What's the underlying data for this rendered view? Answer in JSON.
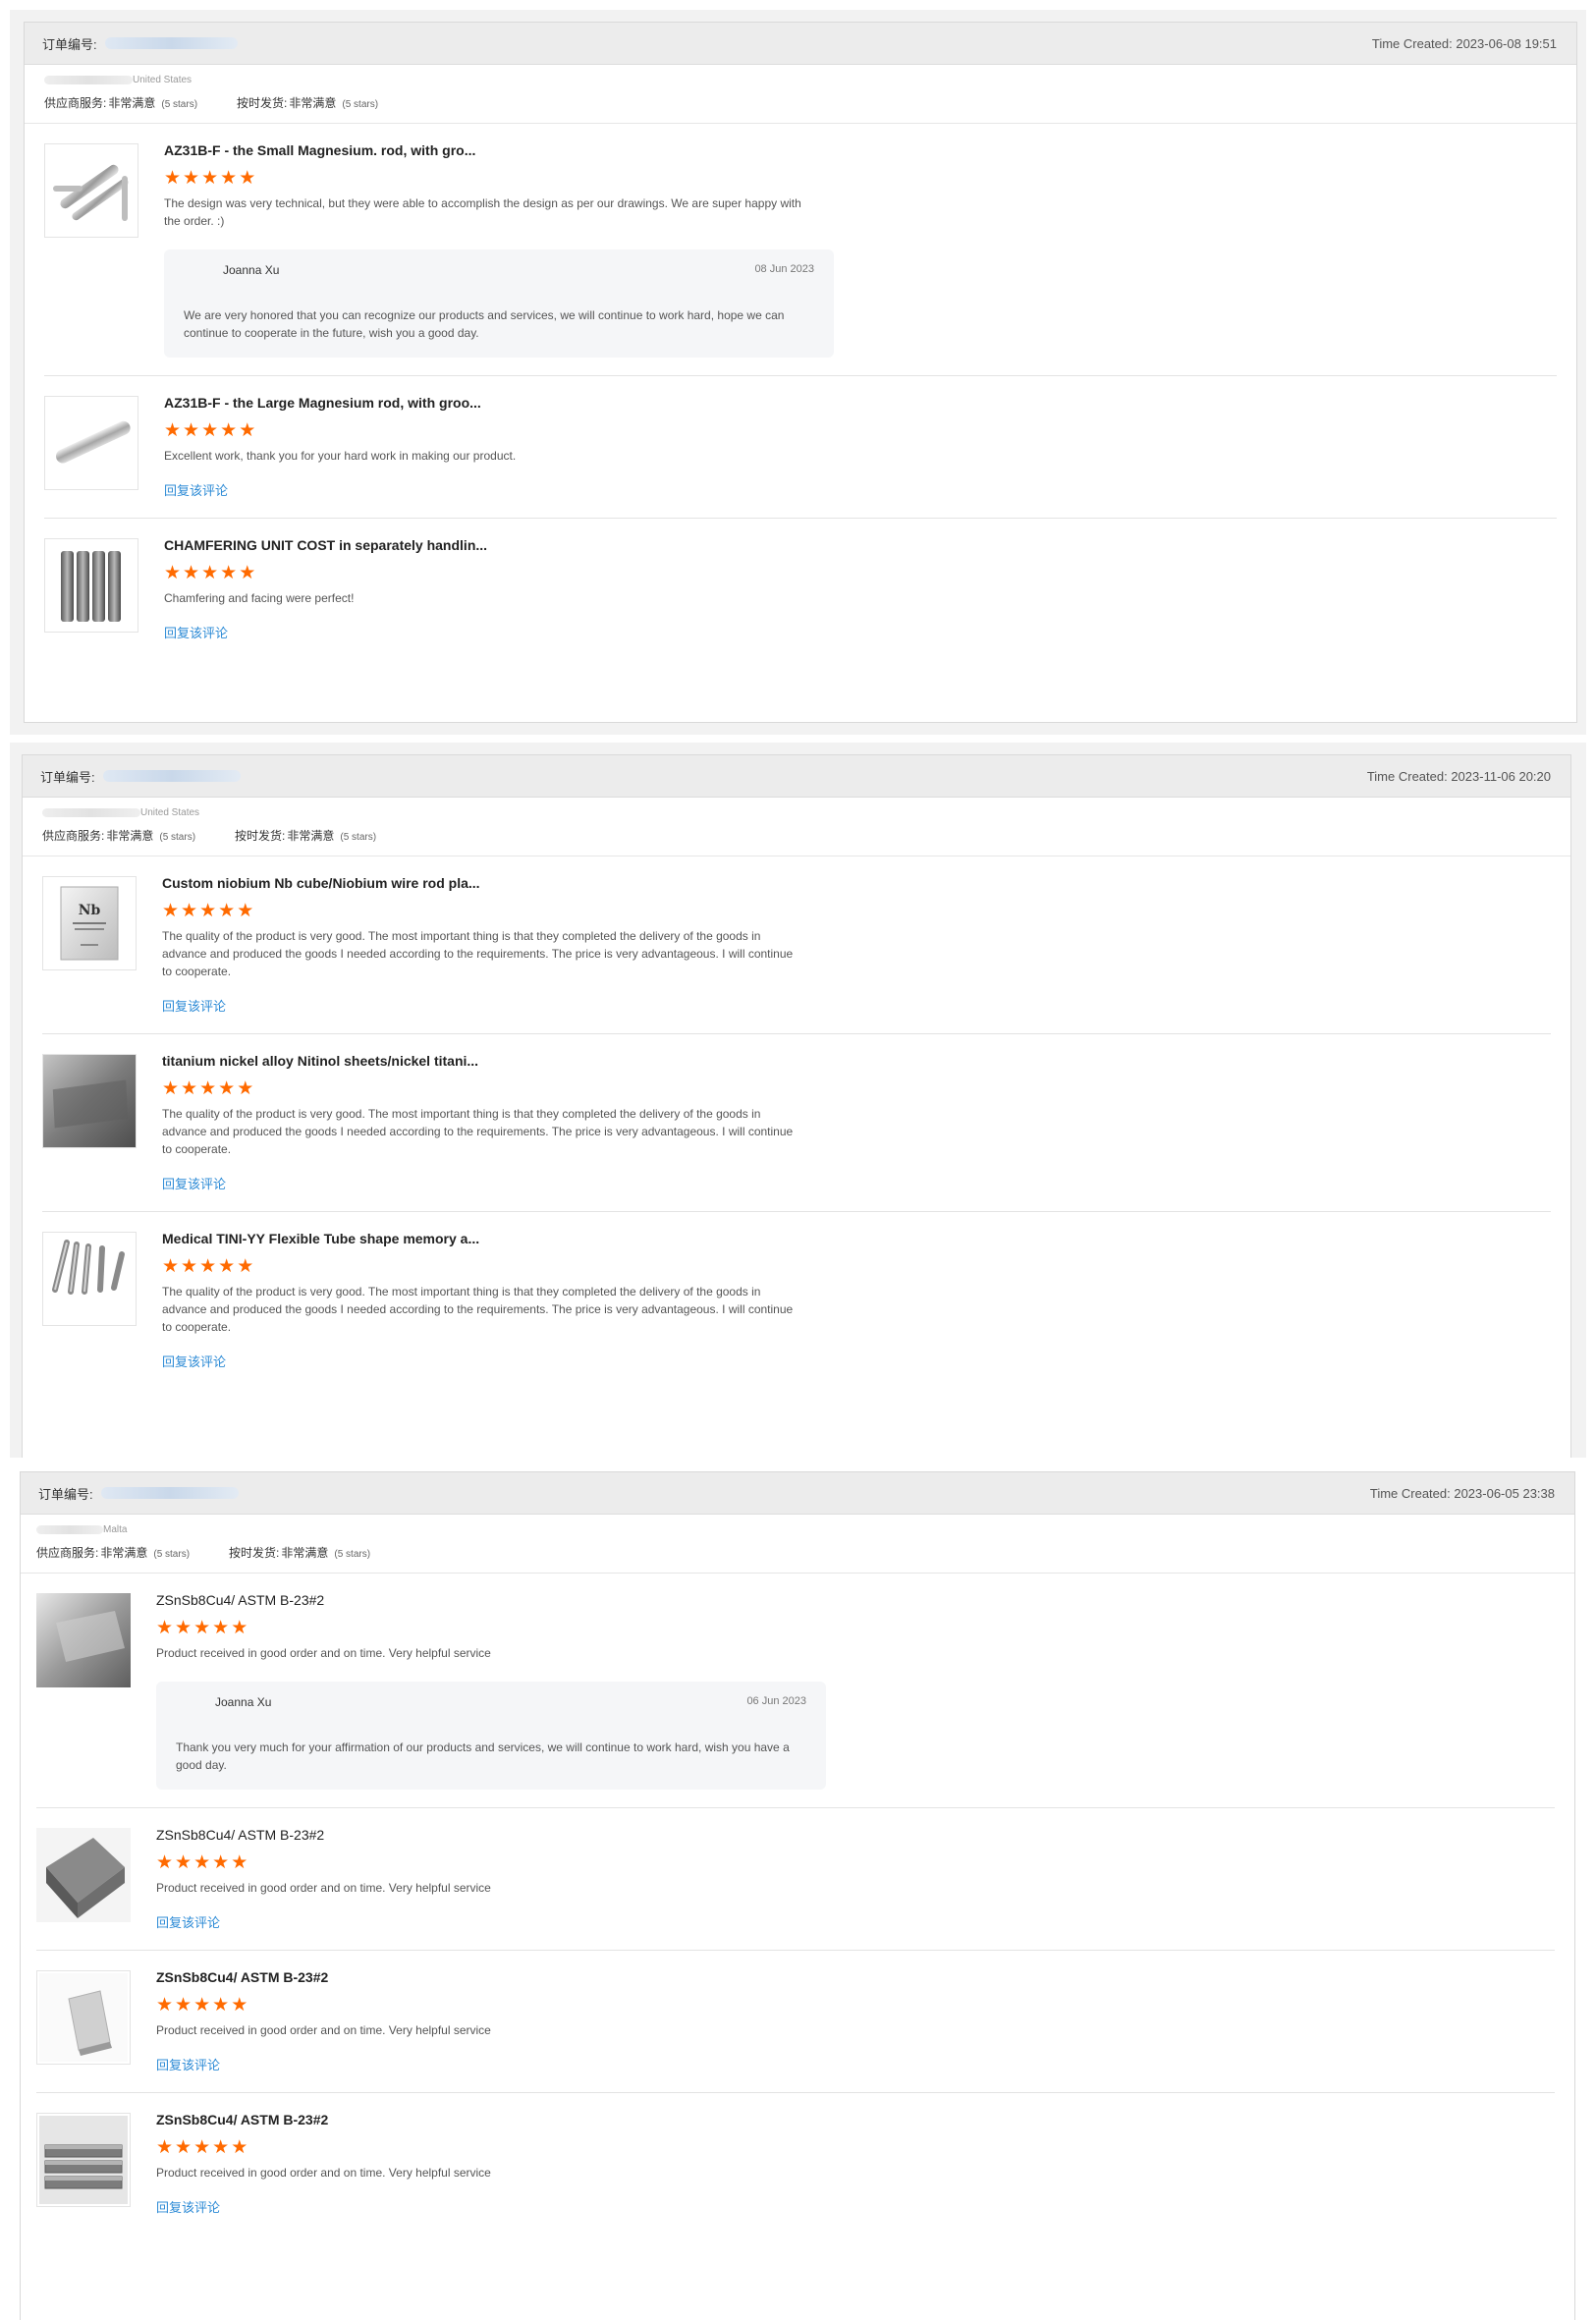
{
  "orders": [
    {
      "order_label": "订单编号:",
      "time_created": "Time Created: 2023-06-08 19:51",
      "country": "United States",
      "supplier_service_label": "供应商服务:",
      "supplier_service_value": "非常满意",
      "supplier_service_stars": "(5 stars)",
      "on_time_label": "按时发货:",
      "on_time_value": "非常满意",
      "on_time_stars": "(5 stars)",
      "items": [
        {
          "title": "AZ31B-F - the Small Magnesium. rod, with gro...",
          "rating": 5,
          "review": "The design was very technical, but they were able to accomplish the design as per our drawings. We are super happy with the order. :)",
          "reply": {
            "name": "Joanna Xu",
            "date": "08 Jun 2023",
            "text": "We are very honored that you can recognize our products and services, we will continue to work hard, hope we can continue to cooperate in the future, wish you a good day."
          }
        },
        {
          "title": "AZ31B-F -  the Large Magnesium rod, with groo...",
          "rating": 5,
          "review": "Excellent work, thank you for your hard work in making our product.",
          "reply_link": "回复该评论"
        },
        {
          "title": "CHAMFERING UNIT COST in separately handlin...",
          "rating": 5,
          "review": "Chamfering and facing were perfect!",
          "reply_link": "回复该评论"
        }
      ]
    },
    {
      "order_label": "订单编号:",
      "time_created": "Time Created: 2023-11-06 20:20",
      "country": "United States",
      "supplier_service_label": "供应商服务:",
      "supplier_service_value": "非常满意",
      "supplier_service_stars": "(5 stars)",
      "on_time_label": "按时发货:",
      "on_time_value": "非常满意",
      "on_time_stars": "(5 stars)",
      "items": [
        {
          "title": "Custom niobium Nb cube/Niobium wire rod pla...",
          "rating": 5,
          "review": "The quality of the product is very good. The most important thing is that they completed the delivery of the goods in advance and produced the goods I needed according to the requirements. The price is very advantageous. I will continue to cooperate.",
          "reply_link": "回复该评论"
        },
        {
          "title": "titanium nickel alloy Nitinol sheets/nickel titani...",
          "rating": 5,
          "review": "The quality of the product is very good. The most important thing is that they completed the delivery of the goods in advance and produced the goods I needed according to the requirements. The price is very advantageous. I will continue to cooperate.",
          "reply_link": "回复该评论"
        },
        {
          "title": "Medical TINI-YY Flexible Tube shape memory a...",
          "rating": 5,
          "review": "The quality of the product is very good. The most important thing is that they completed the delivery of the goods in advance and produced the goods I needed according to the requirements. The price is very advantageous. I will continue to cooperate.",
          "reply_link": "回复该评论"
        }
      ]
    },
    {
      "order_label": "订单编号:",
      "time_created": "Time Created: 2023-06-05 23:38",
      "country": "Malta",
      "supplier_service_label": "供应商服务:",
      "supplier_service_value": "非常满意",
      "supplier_service_stars": "(5 stars)",
      "on_time_label": "按时发货:",
      "on_time_value": "非常满意",
      "on_time_stars": "(5 stars)",
      "items": [
        {
          "title": "ZSnSb8Cu4/ ASTM B-23#2",
          "rating": 5,
          "review": "Product received in good order and on time. Very helpful service",
          "reply": {
            "name": "Joanna Xu",
            "date": "06 Jun 2023",
            "text": "Thank you very much for your affirmation of our products and services, we will continue to work hard, wish you have a good day."
          }
        },
        {
          "title": "ZSnSb8Cu4/ ASTM B-23#2",
          "rating": 5,
          "review": "Product received in good order and on time. Very helpful service",
          "reply_link": "回复该评论"
        },
        {
          "title": "ZSnSb8Cu4/ ASTM B-23#2",
          "rating": 5,
          "review": "Product received in good order and on time. Very helpful service",
          "reply_link": "回复该评论"
        },
        {
          "title": "ZSnSb8Cu4/ ASTM B-23#2",
          "rating": 5,
          "review": "Product received in good order and on time. Very helpful service",
          "reply_link": "回复该评论"
        }
      ]
    }
  ],
  "icons": {
    "star": "★"
  },
  "colors": {
    "star": "#ff6a00",
    "link": "#2d8bd6"
  }
}
